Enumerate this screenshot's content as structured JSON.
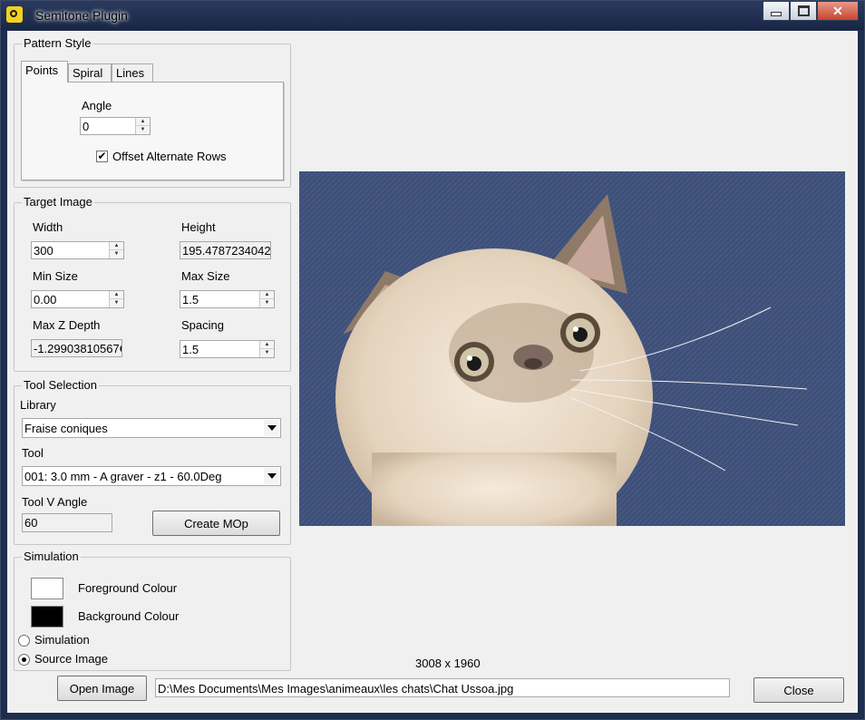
{
  "window": {
    "title": "Semitone Plugin",
    "controls": {
      "minimize": "minimize-icon",
      "maximize": "maximize-icon",
      "close": "close-icon"
    }
  },
  "pattern_style": {
    "title": "Pattern Style",
    "tabs": [
      {
        "label": "Points",
        "active": true
      },
      {
        "label": "Spiral",
        "active": false
      },
      {
        "label": "Lines",
        "active": false
      }
    ],
    "angle_label": "Angle",
    "angle_value": "0",
    "offset_rows_label": "Offset Alternate Rows",
    "offset_rows_checked": true,
    "check_glyph": "✔"
  },
  "target_image": {
    "title": "Target Image",
    "width_label": "Width",
    "width_value": "300",
    "height_label": "Height",
    "height_value": "195.4787234042",
    "min_size_label": "Min Size",
    "min_size_value": "0.00",
    "max_size_label": "Max Size",
    "max_size_value": "1.5",
    "max_z_label": "Max Z Depth",
    "max_z_value": "-1.29903810567€",
    "spacing_label": "Spacing",
    "spacing_value": "1.5"
  },
  "tool_selection": {
    "title": "Tool Selection",
    "library_label": "Library",
    "library_value": "Fraise coniques",
    "tool_label": "Tool",
    "tool_value": "001: 3.0 mm - A graver - z1 - 60.0Deg",
    "v_angle_label": "Tool V Angle",
    "v_angle_value": "60",
    "create_mop_label": "Create MOp"
  },
  "simulation": {
    "title": "Simulation",
    "foreground_label": "Foreground Colour",
    "foreground_color": "#ffffff",
    "background_label": "Background Colour",
    "background_color": "#000000",
    "mode_options": [
      {
        "label": "Simulation",
        "checked": false
      },
      {
        "label": "Source Image",
        "checked": true
      }
    ]
  },
  "preview": {
    "image_dimensions": "3008 x 1960",
    "background_color": "#3b4d72"
  },
  "footer": {
    "open_image_label": "Open Image",
    "file_path": "D:\\Mes Documents\\Mes Images\\animeaux\\les chats\\Chat Ussoa.jpg",
    "close_label": "Close"
  },
  "arrows": {
    "up": "▲",
    "down": "▼"
  }
}
